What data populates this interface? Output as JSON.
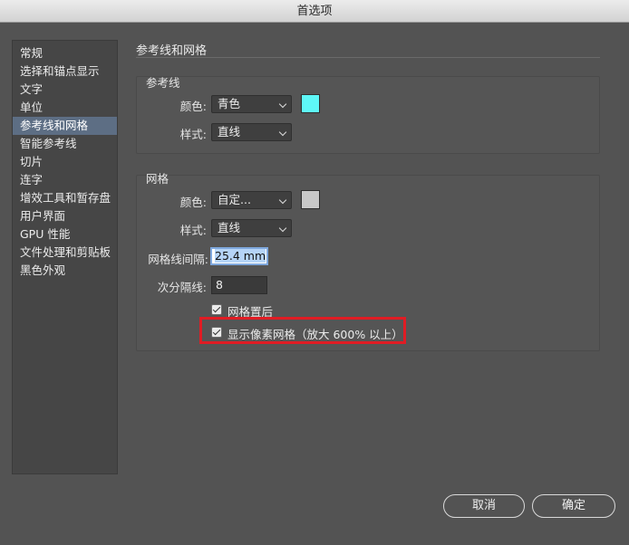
{
  "window": {
    "title": "首选项"
  },
  "sidebar": {
    "items": [
      {
        "label": "常规"
      },
      {
        "label": "选择和锚点显示"
      },
      {
        "label": "文字"
      },
      {
        "label": "单位"
      },
      {
        "label": "参考线和网格",
        "selected": true
      },
      {
        "label": "智能参考线"
      },
      {
        "label": "切片"
      },
      {
        "label": "连字"
      },
      {
        "label": "增效工具和暂存盘"
      },
      {
        "label": "用户界面"
      },
      {
        "label": "GPU 性能"
      },
      {
        "label": "文件处理和剪贴板"
      },
      {
        "label": "黑色外观"
      }
    ]
  },
  "main": {
    "section_title": "参考线和网格",
    "guides": {
      "label": "参考线",
      "color_label": "颜色:",
      "color_value": "青色",
      "color_swatch": "#5ef7f7",
      "style_label": "样式:",
      "style_value": "直线"
    },
    "grid": {
      "label": "网格",
      "color_label": "颜色:",
      "color_value": "自定...",
      "color_swatch": "#c8c8c8",
      "style_label": "样式:",
      "style_value": "直线",
      "spacing_label": "网格线间隔:",
      "spacing_value": "25.4 mm",
      "subdivisions_label": "次分隔线:",
      "subdivisions_value": "8",
      "grids_in_back_label": "网格置后",
      "grids_in_back_checked": true,
      "show_pixel_grid_label": "显示像素网格（放大 600% 以上）",
      "show_pixel_grid_checked": true
    }
  },
  "footer": {
    "cancel_label": "取消",
    "ok_label": "确定"
  },
  "colors": {
    "highlight": "#e01c24",
    "selected_item": "#5d6e84"
  }
}
